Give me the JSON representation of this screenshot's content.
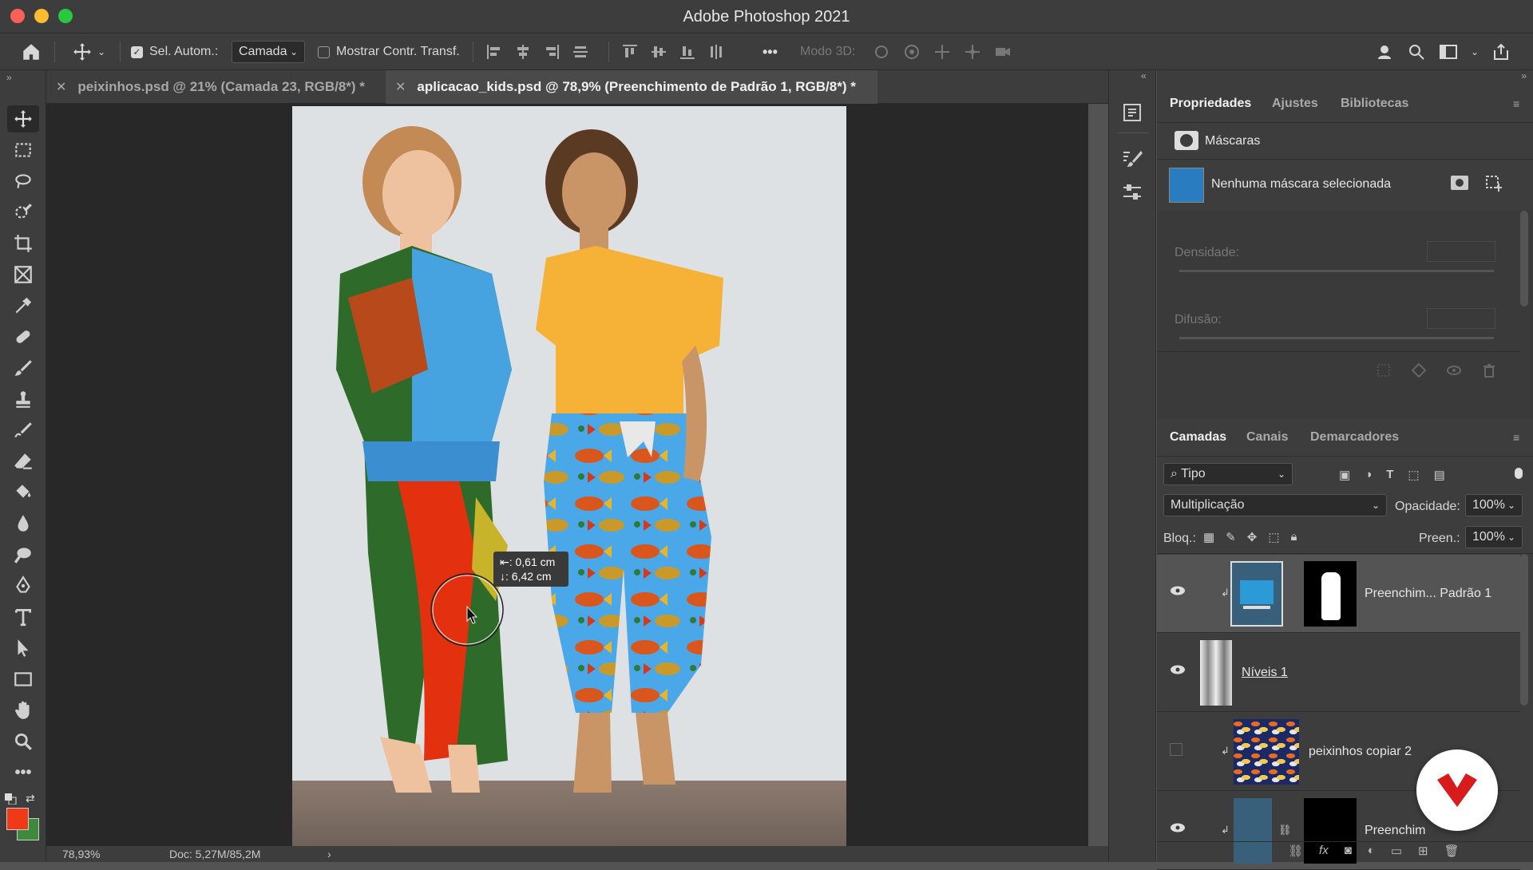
{
  "app": {
    "title": "Adobe Photoshop 2021"
  },
  "options": {
    "auto_select_label": "Sel. Autom.:",
    "auto_select_checked": true,
    "auto_select_target": "Camada",
    "show_transform_label": "Mostrar Contr. Transf.",
    "show_transform_checked": false,
    "mode3d_label": "Modo 3D:",
    "more": "•••"
  },
  "tabs": [
    {
      "label": "peixinhos.psd @ 21% (Camada 23, RGB/8*) *",
      "active": false
    },
    {
      "label": "aplicacao_kids.psd @ 78,9% (Preenchimento de Padrão 1, RGB/8*) *",
      "active": true
    }
  ],
  "canvas": {
    "tooltip_x": "⇤: 0,61 cm",
    "tooltip_y": "↓: 6,42 cm"
  },
  "status": {
    "zoom": "78,93%",
    "doc": "Doc: 5,27M/85,2M",
    "arrow": "›"
  },
  "properties": {
    "tabs": [
      "Propriedades",
      "Ajustes",
      "Bibliotecas"
    ],
    "section": "Máscaras",
    "mask_status": "Nenhuma máscara selecionada",
    "density_label": "Densidade:",
    "feather_label": "Difusão:"
  },
  "layers": {
    "tabs": [
      "Camadas",
      "Canais",
      "Demarcadores"
    ],
    "filter": "Tipo",
    "blend_mode": "Multiplicação",
    "opacity_label": "Opacidade:",
    "opacity": "100%",
    "lock_label": "Bloq.:",
    "fill_label": "Preen.:",
    "fill": "100%",
    "items": [
      {
        "name": "Preenchim... Padrão 1",
        "visible": true,
        "selected": true
      },
      {
        "name": "Níveis 1",
        "visible": true,
        "selected": false
      },
      {
        "name": "peixinhos copiar 2",
        "visible": false,
        "selected": false
      },
      {
        "name": "Preenchim",
        "visible": true,
        "selected": false
      }
    ]
  },
  "colors": {
    "foreground": "#f03a17",
    "background": "#3d8a3d",
    "accent": "#d81c1c"
  }
}
